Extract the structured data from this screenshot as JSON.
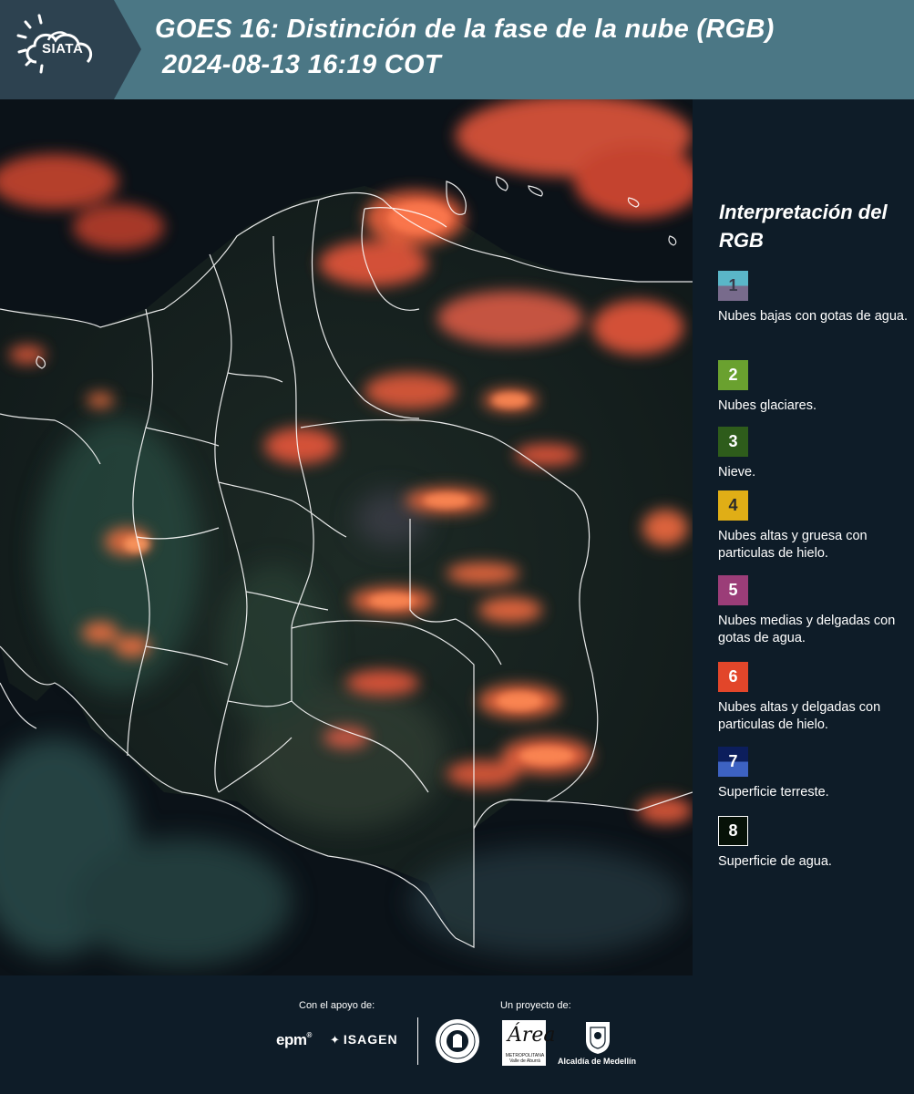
{
  "header": {
    "title_line1": "GOES 16: Distinción de la fase de la nube (RGB)",
    "title_line2": "2024-08-13 16:19 COT",
    "logo_text": "SIATA",
    "background_color": "#4b7785",
    "logo_background_color": "#2d4250"
  },
  "map": {
    "description_icon": "satellite-rgb-cloud-phase-map",
    "boundary_color": "#ffffff"
  },
  "legend": {
    "title": "Interpretación del RGB",
    "items": [
      {
        "number": "1",
        "label": "Nubes bajas con gotas de agua.",
        "color_top": "#5ab6c8",
        "color_bottom": "#786b8c",
        "number_color": "#3a3a4a"
      },
      {
        "number": "2",
        "label": "Nubes glaciares.",
        "color_top": "#6aa12f",
        "color_bottom": "#6aa12f",
        "number_color": "#ffffff"
      },
      {
        "number": "3",
        "label": "Nieve.",
        "color_top": "#2e5c1b",
        "color_bottom": "#2e5c1b",
        "number_color": "#ffffff"
      },
      {
        "number": "4",
        "label": "Nubes altas y gruesa con particulas de hielo.",
        "color_top": "#e0ae16",
        "color_bottom": "#e0ae16",
        "number_color": "#2a2a2a"
      },
      {
        "number": "5",
        "label": "Nubes medias y delgadas con gotas de agua.",
        "color_top": "#9b3d78",
        "color_bottom": "#9b3d78",
        "number_color": "#ffffff"
      },
      {
        "number": "6",
        "label": "Nubes altas y delgadas con particulas de hielo.",
        "color_top": "#e2462a",
        "color_bottom": "#e2462a",
        "number_color": "#ffffff"
      },
      {
        "number": "7",
        "label": "Superficie terreste.",
        "color_top": "#0c1e5c",
        "color_bottom": "#3d62c2",
        "number_color": "#ffffff"
      },
      {
        "number": "8",
        "label": "Superficie de agua.",
        "color_top": "#071208",
        "color_bottom": "#071208",
        "number_color": "#ffffff"
      }
    ]
  },
  "footer": {
    "support_label": "Con el apoyo de:",
    "project_label": "Un proyecto de:",
    "epm_logo": "epm",
    "isagen_logo": "ISAGEN",
    "area_logo_big": "Área",
    "area_logo_small": "METROPOLITANA Valle de Aburrá",
    "alcaldia_label": "Alcaldía de Medellín"
  }
}
